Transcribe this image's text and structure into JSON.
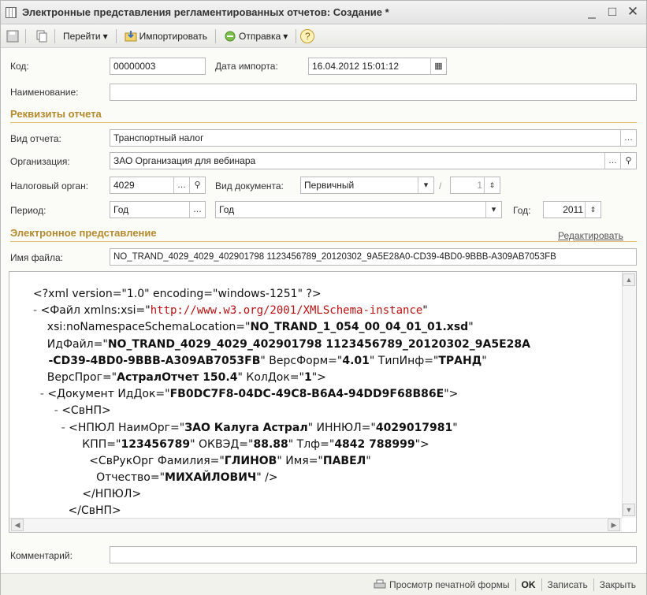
{
  "window": {
    "title": "Электронные представления регламентированных отчетов: Создание *"
  },
  "titlebar_buttons": {
    "minimize": "_",
    "maximize": "□",
    "close": "✕"
  },
  "toolbar": {
    "goto_label": "Перейти",
    "import_label": "Импортировать",
    "send_label": "Отправка",
    "help_label": "?"
  },
  "form": {
    "code_label": "Код:",
    "code_value": "00000003",
    "import_date_label": "Дата импорта:",
    "import_date_value": "16.04.2012 15:01:12",
    "name_label": "Наименование:",
    "name_value": "",
    "requisites_header": "Реквизиты отчета",
    "report_type_label": "Вид отчета:",
    "report_type_value": "Транспортный налог",
    "org_label": "Организация:",
    "org_value": "ЗАО Организация для вебинара",
    "tax_authority_label": "Налоговый орган:",
    "tax_authority_value": "4029",
    "doc_type_label": "Вид документа:",
    "doc_type_value": "Первичный",
    "slash": "/",
    "correction_number": "1",
    "period_label": "Период:",
    "period_short_value": "Год",
    "period_value": "Год",
    "year_label": "Год:",
    "year_value": "2011",
    "electronic_header": "Электронное представление",
    "edit_link": "Редактировать",
    "filename_label": "Имя файла:",
    "filename_value": "NO_TRAND_4029_4029_402901798 1123456789_20120302_9A5E28A0-CD39-4BD0-9BBB-A309AB7053FB",
    "comment_label": "Комментарий:",
    "comment_value": ""
  },
  "xml_lines": [
    {
      "pre": "<?xml version=\"1.0\" encoding=\"windows-1251\" ?>"
    },
    {
      "minus": "- ",
      "pre": "<Файл xmlns:xsi=\"",
      "url": "http://www.w3.org/2001/XMLSchema-instance",
      "post": "\""
    },
    {
      "pre": "    xsi:noNamespaceSchemaLocation=\"",
      "bold": "NO_TRAND_1_054_00_04_01_01.xsd",
      "post": "\""
    },
    {
      "pre": "    ИдФайл=\"",
      "bold": "NO_TRAND_4029_4029_402901798 1123456789_20120302_9A5E28A"
    },
    {
      "bold": "    -CD39-4BD0-9BBB-A309AB7053FB",
      "pre": "\" ВерсФорм=\"",
      "bold2": "4.01",
      "post": "\" ТипИнф=\"",
      "bold3": "ТРАНД",
      "post2": "\""
    },
    {
      "pre": "    ВерсПрог=\"",
      "bold": "АстралОтчет 150.4",
      "post": "\" КолДок=\"",
      "bold2": "1",
      "post2": "\">"
    },
    {
      "minus": "  - ",
      "pre": "<Документ ИдДок=\"",
      "bold": "FB0DC7F8-04DC-49C8-B6A4-94DD9F68B86E",
      "post": "\">"
    },
    {
      "minus": "      - ",
      "pre": "<СвНП>"
    },
    {
      "minus": "        - ",
      "pre": "<НПЮЛ НаимОрг=\"",
      "bold": "ЗАО Калуга Астрал",
      "post": "\" ИННЮЛ=\"",
      "bold2": "4029017981",
      "post2": "\""
    },
    {
      "pre": "              КПП=\"",
      "bold": "123456789",
      "post": "\" ОКВЭД=\"",
      "bold2": "88.88",
      "post2": "\" Тлф=\"",
      "bold3": "4842 788999",
      "post3": "\">"
    },
    {
      "pre": "                <СвРукОрг Фамилия=\"",
      "bold": "ГЛИНОВ",
      "post": "\" Имя=\"",
      "bold2": "ПАВЕЛ",
      "post2": "\""
    },
    {
      "pre": "                  Отчество=\"",
      "bold": "МИХАЙЛОВИЧ",
      "post": "\" />"
    },
    {
      "pre": "              </НПЮЛ>"
    },
    {
      "pre": "          </СвНП>"
    }
  ],
  "footer": {
    "print_label": "Просмотр печатной формы",
    "ok_label": "OK",
    "save_label": "Записать",
    "close_label": "Закрыть"
  },
  "colors": {
    "section": "#b48a2c",
    "url": "#bb1111"
  }
}
